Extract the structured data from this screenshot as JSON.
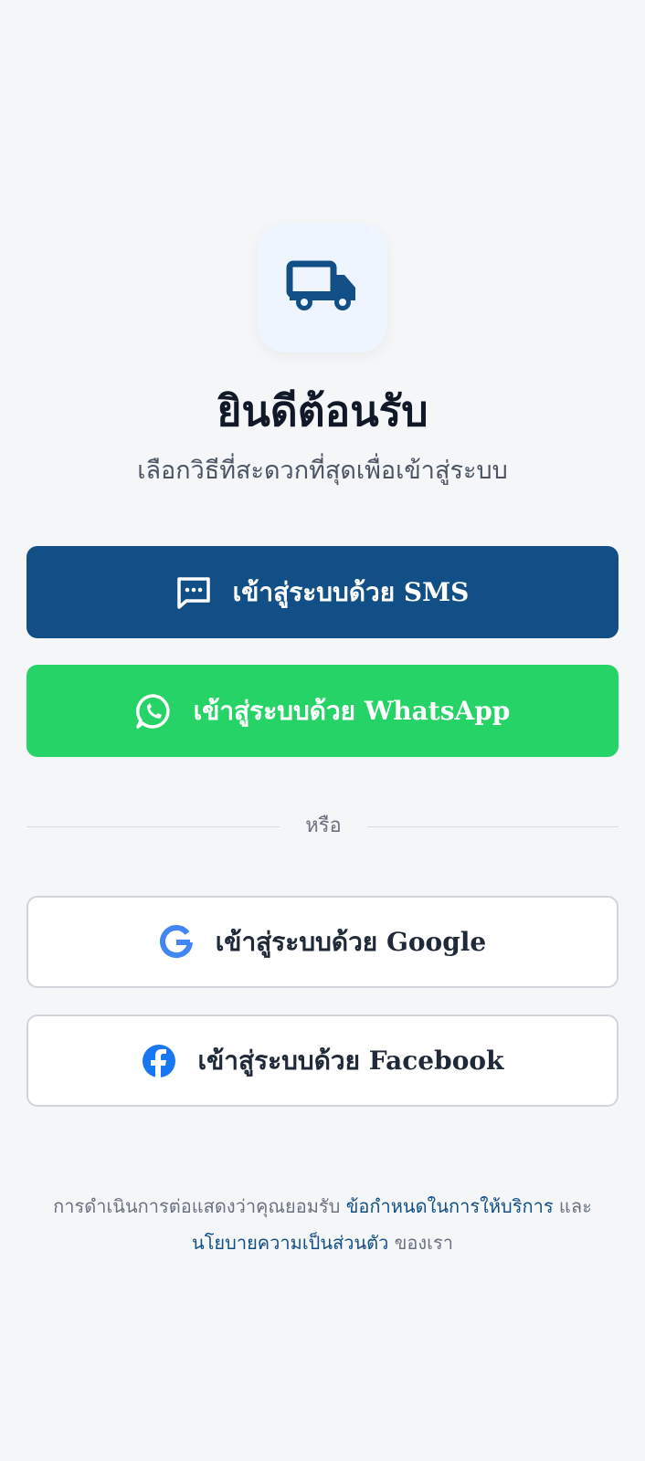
{
  "logo": {
    "icon": "truck-icon",
    "color": "#124f87"
  },
  "title": "ยินดีต้อนรับ",
  "subtitle": "เลือกวิธีที่สะดวกที่สุดเพื่อเข้าสู่ระบบ",
  "buttons": {
    "sms": {
      "label": "เข้าสู่ระบบด้วย SMS",
      "icon": "message-icon",
      "color": "#124f87"
    },
    "whatsapp": {
      "label": "เข้าสู่ระบบด้วย WhatsApp",
      "icon": "whatsapp-icon",
      "color": "#25d366"
    },
    "google": {
      "label": "เข้าสู่ระบบด้วย Google",
      "icon": "google-icon"
    },
    "facebook": {
      "label": "เข้าสู่ระบบด้วย Facebook",
      "icon": "facebook-icon",
      "color": "#1877f2"
    }
  },
  "divider": {
    "text": "หรือ"
  },
  "footer": {
    "prefix": "การดำเนินการต่อแสดงว่าคุณยอมรับ",
    "terms_link": "ข้อกำหนดในการให้บริการ",
    "and": "และ",
    "privacy_link": "นโยบายความเป็นส่วนตัว",
    "suffix": "ของเรา",
    "link_color": "#124f87"
  }
}
